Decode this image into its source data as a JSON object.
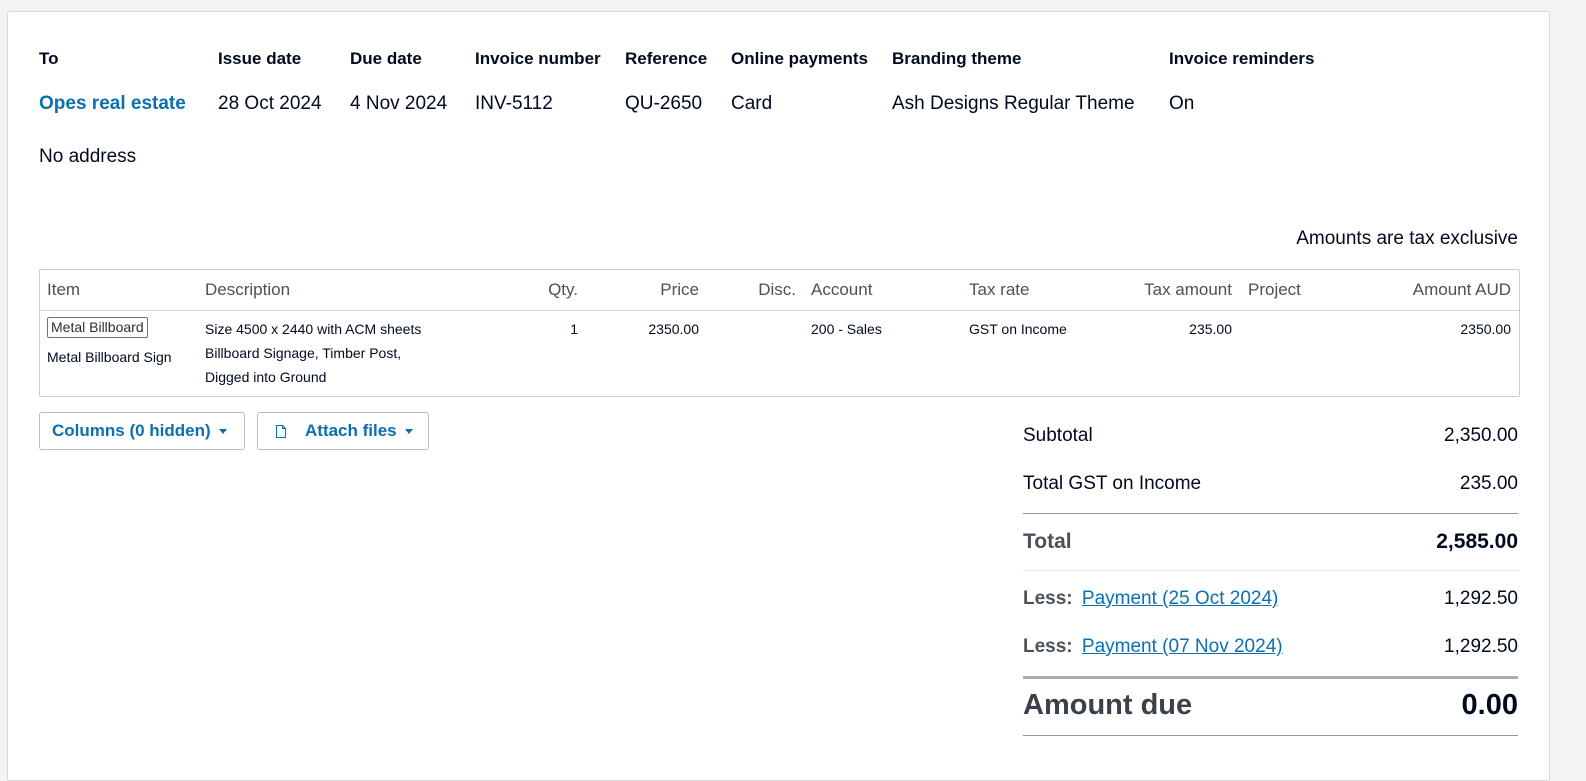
{
  "header": {
    "columns": [
      {
        "label": "To",
        "value": "Opes real estate"
      },
      {
        "label": "Issue date",
        "value": "28 Oct 2024"
      },
      {
        "label": "Due date",
        "value": "4 Nov 2024"
      },
      {
        "label": "Invoice number",
        "value": "INV-5112"
      },
      {
        "label": "Reference",
        "value": "QU-2650"
      },
      {
        "label": "Online payments",
        "value": "Card"
      },
      {
        "label": "Branding theme",
        "value": "Ash Designs Regular Theme"
      },
      {
        "label": "Invoice reminders",
        "value": "On"
      }
    ],
    "address": "No address",
    "tax_mode": "Amounts are tax exclusive"
  },
  "items_table": {
    "headers": {
      "item": "Item",
      "description": "Description",
      "qty": "Qty.",
      "price": "Price",
      "disc": "Disc.",
      "account": "Account",
      "tax_rate": "Tax rate",
      "tax_amount": "Tax amount",
      "project": "Project",
      "amount": "Amount AUD"
    },
    "rows": [
      {
        "item_code": "Metal Billboard",
        "item_name": "Metal Billboard Sign",
        "description_lines": [
          "Size 4500 x 2440 with ACM sheets",
          "Billboard Signage, Timber Post,",
          "Digged into Ground"
        ],
        "qty": "1",
        "price": "2350.00",
        "disc": "",
        "account": "200 - Sales",
        "tax_rate": "GST on Income",
        "tax_amount": "235.00",
        "project": "",
        "amount": "2350.00"
      }
    ]
  },
  "buttons": {
    "columns_label": "Columns (0 hidden)",
    "attach_label": "Attach files"
  },
  "totals": {
    "subtotal_label": "Subtotal",
    "subtotal_value": "2,350.00",
    "gst_label": "Total GST on Income",
    "gst_value": "235.00",
    "total_label": "Total",
    "total_value": "2,585.00",
    "payments": [
      {
        "prefix": "Less:",
        "link": "Payment (25 Oct 2024)",
        "value": "1,292.50"
      },
      {
        "prefix": "Less:",
        "link": "Payment (07 Nov 2024)",
        "value": "1,292.50"
      }
    ],
    "amount_due_label": "Amount due",
    "amount_due_value": "0.00"
  },
  "colors": {
    "link": "#0b6fb0",
    "text": "#000a1e",
    "muted": "#4a5159"
  },
  "icons": {
    "attach": "file-icon",
    "dropdown": "caret-down-icon"
  }
}
